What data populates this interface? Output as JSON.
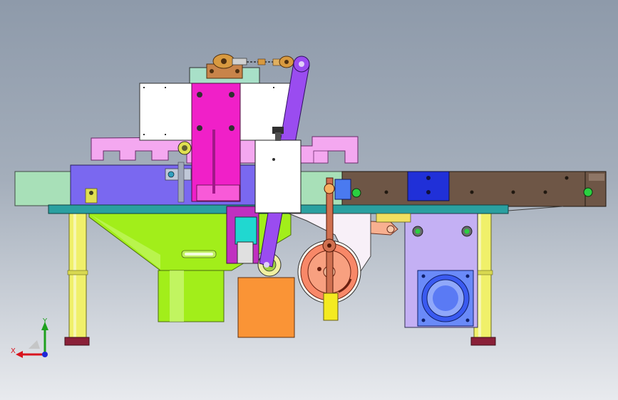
{
  "viewport": {
    "background_top": "#8e9aaa",
    "background_bottom": "#e8eaee"
  },
  "triad": {
    "x_label": "X",
    "y_label": "Y",
    "x_color": "#d8141e",
    "y_color": "#1ea01e",
    "z_color": "#1e28d8"
  },
  "colors": {
    "frame_green": "#a8e0b8",
    "blue_block": "#7a68f0",
    "pink_comb": "#f4a8f0",
    "magenta_block": "#f020c8",
    "white_housing": "#ffffff",
    "purple_link": "#9a4cf0",
    "hopper_green": "#a2ee1a",
    "orange_box": "#fa9436",
    "salmon_wheel": "#f88868",
    "brown_rail": "#6e5646",
    "lavender_plate": "#c4b0f4",
    "motor_blue": "#5a7af4",
    "post_yellow": "#f0f06a",
    "foot_maroon": "#8a2038",
    "cyan_block": "#20d8d0",
    "teal_base": "#2aa0a0"
  }
}
